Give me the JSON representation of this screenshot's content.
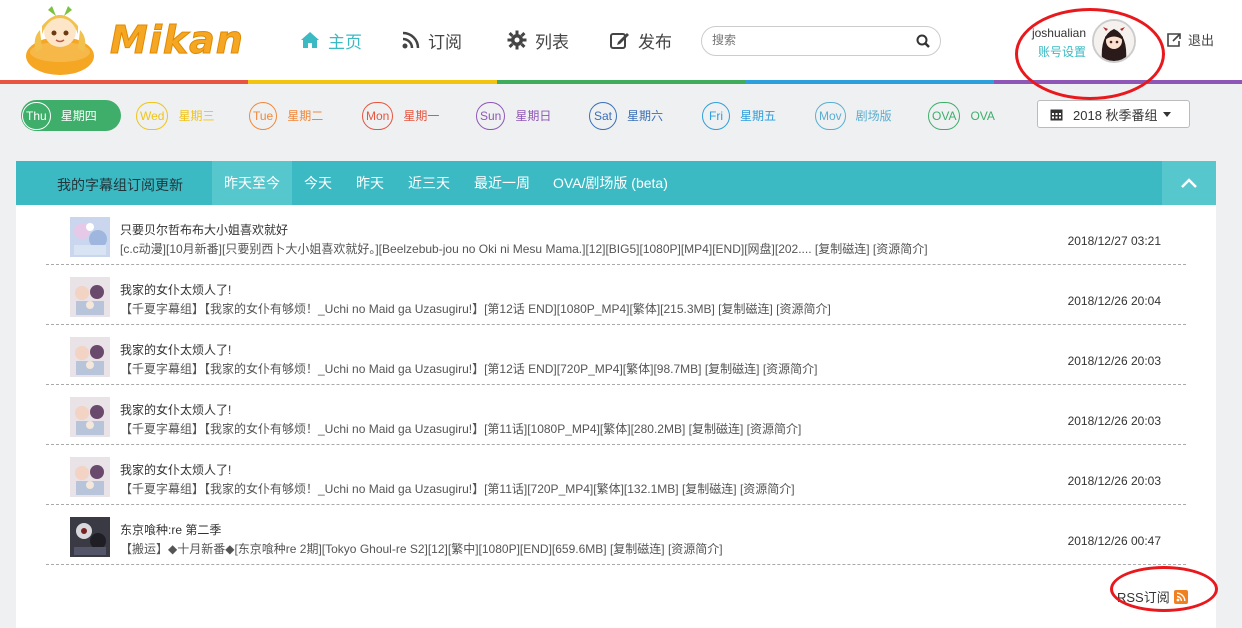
{
  "brand": {
    "name": "Mikan",
    "color": "#f5a623"
  },
  "nav": [
    {
      "label": "主页",
      "icon": "home-icon",
      "active": true
    },
    {
      "label": "订阅",
      "icon": "rss-icon",
      "active": false
    },
    {
      "label": "列表",
      "icon": "gear-icon",
      "active": false
    },
    {
      "label": "发布",
      "icon": "edit-icon",
      "active": false
    }
  ],
  "search": {
    "placeholder": "搜索",
    "icon": "search-icon"
  },
  "user": {
    "name": "joshualian",
    "account_label": "账号设置",
    "logout_label": "退出"
  },
  "rainbow_colors": [
    "#e8543f",
    "#f2c40f",
    "#3eac5b",
    "#2d9fdc",
    "#8e57b7"
  ],
  "weekdays": [
    {
      "abbr": "Thu",
      "label": "星期四",
      "color": "#3fae6a",
      "active": true
    },
    {
      "abbr": "Wed",
      "label": "星期三",
      "color": "#f0c419",
      "active": false
    },
    {
      "abbr": "Tue",
      "label": "星期二",
      "color": "#f0883a",
      "active": false
    },
    {
      "abbr": "Mon",
      "label": "星期一",
      "color": "#e8543f",
      "active": false
    },
    {
      "abbr": "Sun",
      "label": "星期日",
      "color": "#8e57b7",
      "active": false
    },
    {
      "abbr": "Sat",
      "label": "星期六",
      "color": "#3a6fb6",
      "active": false
    },
    {
      "abbr": "Fri",
      "label": "星期五",
      "color": "#2d9fdc",
      "active": false
    },
    {
      "abbr": "Mov",
      "label": "剧场版",
      "color": "#5aaed0",
      "active": false
    },
    {
      "abbr": "OVA",
      "label": "OVA",
      "color": "#3fae6a",
      "active": false
    }
  ],
  "season": {
    "label": "2018 秋季番组",
    "icon": "calendar-icon"
  },
  "panel": {
    "title": "我的字幕组订阅更新",
    "tabs": [
      "昨天至今",
      "今天",
      "昨天",
      "近三天",
      "最近一周",
      "OVA/剧场版 (beta)"
    ],
    "active_tab": 0,
    "accent": "#3bbac4"
  },
  "items": [
    {
      "title": "只要贝尔哲布布大小姐喜欢就好",
      "sub": "[c.c动漫][10月新番][只要别西卜大小姐喜欢就好。][Beelzebub-jou no Oki ni Mesu Mama.][12][BIG5][1080P][MP4][END][网盘][202.... [复制磁连] [资源简介]",
      "date": "2018/12/27 03:21"
    },
    {
      "title": "我家的女仆太烦人了!",
      "sub": "【千夏字幕组】【我家的女仆有够烦！_Uchi no Maid ga Uzasugiru!】[第12话 END][1080P_MP4][繁体][215.3MB] [复制磁连] [资源简介]",
      "date": "2018/12/26 20:04"
    },
    {
      "title": "我家的女仆太烦人了!",
      "sub": "【千夏字幕组】【我家的女仆有够烦！_Uchi no Maid ga Uzasugiru!】[第12话 END][720P_MP4][繁体][98.7MB] [复制磁连] [资源简介]",
      "date": "2018/12/26 20:03"
    },
    {
      "title": "我家的女仆太烦人了!",
      "sub": "【千夏字幕组】【我家的女仆有够烦！_Uchi no Maid ga Uzasugiru!】[第11话][1080P_MP4][繁体][280.2MB] [复制磁连] [资源简介]",
      "date": "2018/12/26 20:03"
    },
    {
      "title": "我家的女仆太烦人了!",
      "sub": "【千夏字幕组】【我家的女仆有够烦！_Uchi no Maid ga Uzasugiru!】[第11话][720P_MP4][繁体][132.1MB] [复制磁连] [资源简介]",
      "date": "2018/12/26 20:03"
    },
    {
      "title": "东京喰种:re 第二季",
      "sub": "【搬运】◆十月新番◆[东京喰种re 2期][Tokyo Ghoul-re S2][12][繁中][1080P][END][659.6MB] [复制磁连] [资源简介]",
      "date": "2018/12/26 00:47"
    }
  ],
  "rss": {
    "label": "RSS订阅",
    "icon": "rss-feed-icon",
    "color": "#f08020"
  },
  "annotation_color": "#e8181d"
}
